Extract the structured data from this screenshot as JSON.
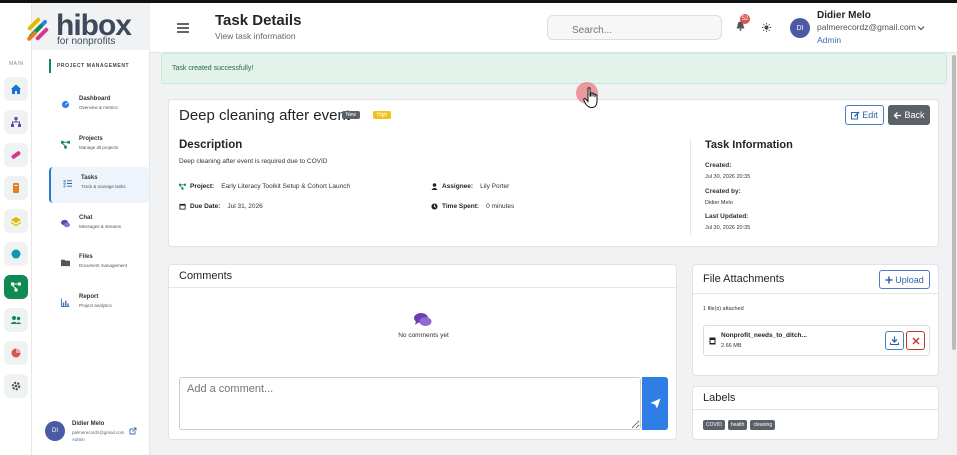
{
  "app": {
    "logo_word": "hibox",
    "logo_sub": "for nonprofits"
  },
  "rail": {
    "main_label": "MAIN"
  },
  "nav": {
    "section": "PROJECT MANAGEMENT",
    "items": [
      {
        "label": "Dashboard",
        "sub": "Overview & metrics"
      },
      {
        "label": "Projects",
        "sub": "Manage all projects"
      },
      {
        "label": "Tasks",
        "sub": "Track & manage tasks"
      },
      {
        "label": "Chat",
        "sub": "Messages & streams"
      },
      {
        "label": "Files",
        "sub": "Document management"
      },
      {
        "label": "Report",
        "sub": "Project analytics"
      }
    ],
    "user": {
      "initials": "DI",
      "name": "Didier Melo",
      "email": "palmerecordz@gmail.com",
      "role": "Admin"
    }
  },
  "header": {
    "title": "Task Details",
    "subtitle": "View task information",
    "search_placeholder": "Search...",
    "notif_count": "52",
    "user": {
      "initials": "DI",
      "name": "Didier Melo",
      "email": "palmerecordz@gmail.com",
      "role": "Admin"
    }
  },
  "alert": {
    "text": "Task created successfully!"
  },
  "task": {
    "title": "Deep cleaning after event",
    "status_badge": "New",
    "priority_badge": "High",
    "edit_label": "Edit",
    "back_label": "Back",
    "description_heading": "Description",
    "description": "Deep cleaning after event is required due to COVID",
    "project_label": "Project:",
    "project": "Early Literacy Toolkit Setup & Cohort Launch",
    "assignee_label": "Assignee:",
    "assignee": "Lily Porter",
    "due_label": "Due Date:",
    "due": "Jul 31, 2026",
    "time_label": "Time Spent:",
    "time": "0 minutes"
  },
  "info": {
    "heading": "Task Information",
    "created_label": "Created:",
    "created": "Jul 30, 2026 20:35",
    "created_by_label": "Created by:",
    "created_by": "Didier Melo",
    "updated_label": "Last Updated:",
    "updated": "Jul 30, 2026 20:35"
  },
  "comments": {
    "heading": "Comments",
    "empty": "No comments yet",
    "placeholder": "Add a comment..."
  },
  "attachments": {
    "heading": "File Attachments",
    "upload_label": "Upload",
    "count": "1 file(s) attached",
    "file": {
      "name": "Nonprofit_needs_to_ditch...",
      "size": "2.66 MB"
    }
  },
  "labels": {
    "heading": "Labels",
    "tags": [
      "COVID",
      "health",
      "cleaning"
    ]
  },
  "colors": {
    "accent_green": "#0e8a52",
    "primary_blue": "#2f7ee6",
    "success_bg": "#e3f3ec",
    "danger": "#c9302c"
  }
}
